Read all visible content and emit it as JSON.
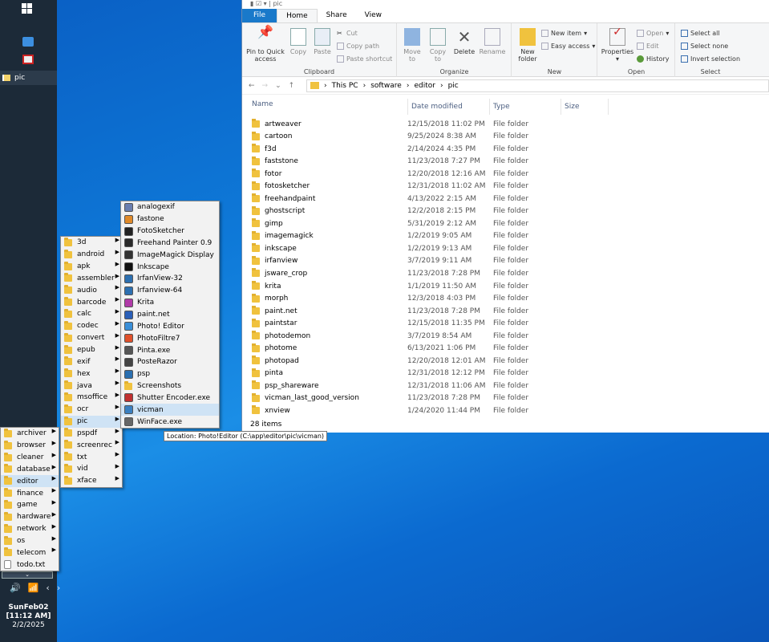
{
  "taskbar": {
    "task_label": "pic",
    "clock_day": "SunFeb02",
    "clock_time": "[11:12 AM]",
    "clock_date": "2/2/2025",
    "tray": [
      "🔊",
      "📶",
      "‹",
      "›"
    ]
  },
  "menu_root": [
    {
      "label": "archiver",
      "arrow": true
    },
    {
      "label": "browser",
      "arrow": true
    },
    {
      "label": "cleaner",
      "arrow": true
    },
    {
      "label": "database",
      "arrow": true
    },
    {
      "label": "editor",
      "arrow": true,
      "highlight": true
    },
    {
      "label": "finance",
      "arrow": true
    },
    {
      "label": "game",
      "arrow": true
    },
    {
      "label": "hardware",
      "arrow": true
    },
    {
      "label": "network",
      "arrow": true
    },
    {
      "label": "os",
      "arrow": true
    },
    {
      "label": "telecom",
      "arrow": true
    },
    {
      "label": "todo.txt",
      "arrow": false,
      "file": true
    }
  ],
  "menu_editor": [
    {
      "label": "3d"
    },
    {
      "label": "android"
    },
    {
      "label": "apk"
    },
    {
      "label": "assembler"
    },
    {
      "label": "audio"
    },
    {
      "label": "barcode"
    },
    {
      "label": "calc"
    },
    {
      "label": "codec"
    },
    {
      "label": "convert"
    },
    {
      "label": "epub"
    },
    {
      "label": "exif"
    },
    {
      "label": "hex"
    },
    {
      "label": "java"
    },
    {
      "label": "msoffice"
    },
    {
      "label": "ocr"
    },
    {
      "label": "pic",
      "highlight": true
    },
    {
      "label": "pspdf"
    },
    {
      "label": "screenrec"
    },
    {
      "label": "txt"
    },
    {
      "label": "vid"
    },
    {
      "label": "xface"
    }
  ],
  "menu_pic": [
    {
      "label": "analogexif",
      "color": "#6a7fb0"
    },
    {
      "label": "fastone",
      "color": "#e08a2a"
    },
    {
      "label": "FotoSketcher",
      "color": "#222"
    },
    {
      "label": "Freehand Painter 0.9",
      "color": "#2a2a2a"
    },
    {
      "label": "ImageMagick Display",
      "color": "#333"
    },
    {
      "label": "Inkscape",
      "color": "#111"
    },
    {
      "label": "IrfanView-32",
      "color": "#2c6fb0"
    },
    {
      "label": "Irfanview-64",
      "color": "#2c6fb0"
    },
    {
      "label": "Krita",
      "color": "#b03aa8"
    },
    {
      "label": "paint.net",
      "color": "#2a5fb8"
    },
    {
      "label": "Photo! Editor",
      "color": "#3a8fd8"
    },
    {
      "label": "PhotoFiltre7",
      "color": "#e0502a"
    },
    {
      "label": "Pinta.exe",
      "color": "#555"
    },
    {
      "label": "PosteRazor",
      "color": "#444"
    },
    {
      "label": "psp",
      "color": "#2a6fb0"
    },
    {
      "label": "Screenshots",
      "color": "#f0c23e",
      "folder": true
    },
    {
      "label": "Shutter Encoder.exe",
      "color": "#c03030"
    },
    {
      "label": "vicman",
      "color": "#3a7fc0",
      "highlight": true
    },
    {
      "label": "WinFace.exe",
      "color": "#666"
    }
  ],
  "tooltip": "Location: Photo!Editor (C:\\app\\editor\\pic\\vicman)",
  "explorer": {
    "title": "pic",
    "tabs": [
      "File",
      "Home",
      "Share",
      "View"
    ],
    "ribbon": {
      "pin": "Pin to Quick access",
      "copy": "Copy",
      "paste": "Paste",
      "cut": "Cut",
      "copy_path": "Copy path",
      "paste_shortcut": "Paste shortcut",
      "clipboard": "Clipboard",
      "move_to": "Move to",
      "copy_to": "Copy to",
      "delete": "Delete",
      "rename": "Rename",
      "organize": "Organize",
      "new_folder": "New folder",
      "new_item": "New item",
      "easy_access": "Easy access",
      "new": "New",
      "properties": "Properties",
      "open": "Open",
      "edit": "Edit",
      "history": "History",
      "open_group": "Open",
      "select_all": "Select all",
      "select_none": "Select none",
      "invert_selection": "Invert selection",
      "select": "Select"
    },
    "breadcrumb": [
      "This PC",
      "software",
      "editor",
      "pic"
    ],
    "columns": [
      "Name",
      "Date modified",
      "Type",
      "Size"
    ],
    "items": [
      {
        "name": "artweaver",
        "date": "12/15/2018 11:02 PM",
        "type": "File folder"
      },
      {
        "name": "cartoon",
        "date": "9/25/2024 8:38 AM",
        "type": "File folder"
      },
      {
        "name": "f3d",
        "date": "2/14/2024 4:35 PM",
        "type": "File folder"
      },
      {
        "name": "faststone",
        "date": "11/23/2018 7:27 PM",
        "type": "File folder"
      },
      {
        "name": "fotor",
        "date": "12/20/2018 12:16 AM",
        "type": "File folder"
      },
      {
        "name": "fotosketcher",
        "date": "12/31/2018 11:02 AM",
        "type": "File folder"
      },
      {
        "name": "freehandpaint",
        "date": "4/13/2022 2:15 AM",
        "type": "File folder"
      },
      {
        "name": "ghostscript",
        "date": "12/2/2018 2:15 PM",
        "type": "File folder"
      },
      {
        "name": "gimp",
        "date": "5/31/2019 2:12 AM",
        "type": "File folder"
      },
      {
        "name": "imagemagick",
        "date": "1/2/2019 9:05 AM",
        "type": "File folder"
      },
      {
        "name": "inkscape",
        "date": "1/2/2019 9:13 AM",
        "type": "File folder"
      },
      {
        "name": "irfanview",
        "date": "3/7/2019 9:11 AM",
        "type": "File folder"
      },
      {
        "name": "jsware_crop",
        "date": "11/23/2018 7:28 PM",
        "type": "File folder"
      },
      {
        "name": "krita",
        "date": "1/1/2019 11:50 AM",
        "type": "File folder"
      },
      {
        "name": "morph",
        "date": "12/3/2018 4:03 PM",
        "type": "File folder"
      },
      {
        "name": "paint.net",
        "date": "11/23/2018 7:28 PM",
        "type": "File folder"
      },
      {
        "name": "paintstar",
        "date": "12/15/2018 11:35 PM",
        "type": "File folder"
      },
      {
        "name": "photodemon",
        "date": "3/7/2019 8:54 AM",
        "type": "File folder"
      },
      {
        "name": "photome",
        "date": "6/13/2021 1:06 PM",
        "type": "File folder"
      },
      {
        "name": "photopad",
        "date": "12/20/2018 12:01 AM",
        "type": "File folder"
      },
      {
        "name": "pinta",
        "date": "12/31/2018 12:12 PM",
        "type": "File folder"
      },
      {
        "name": "psp_shareware",
        "date": "12/31/2018 11:06 AM",
        "type": "File folder"
      },
      {
        "name": "vicman_last_good_version",
        "date": "11/23/2018 7:28 PM",
        "type": "File folder"
      },
      {
        "name": "xnview",
        "date": "1/24/2020 11:44 PM",
        "type": "File folder"
      }
    ],
    "status": "28 items"
  }
}
